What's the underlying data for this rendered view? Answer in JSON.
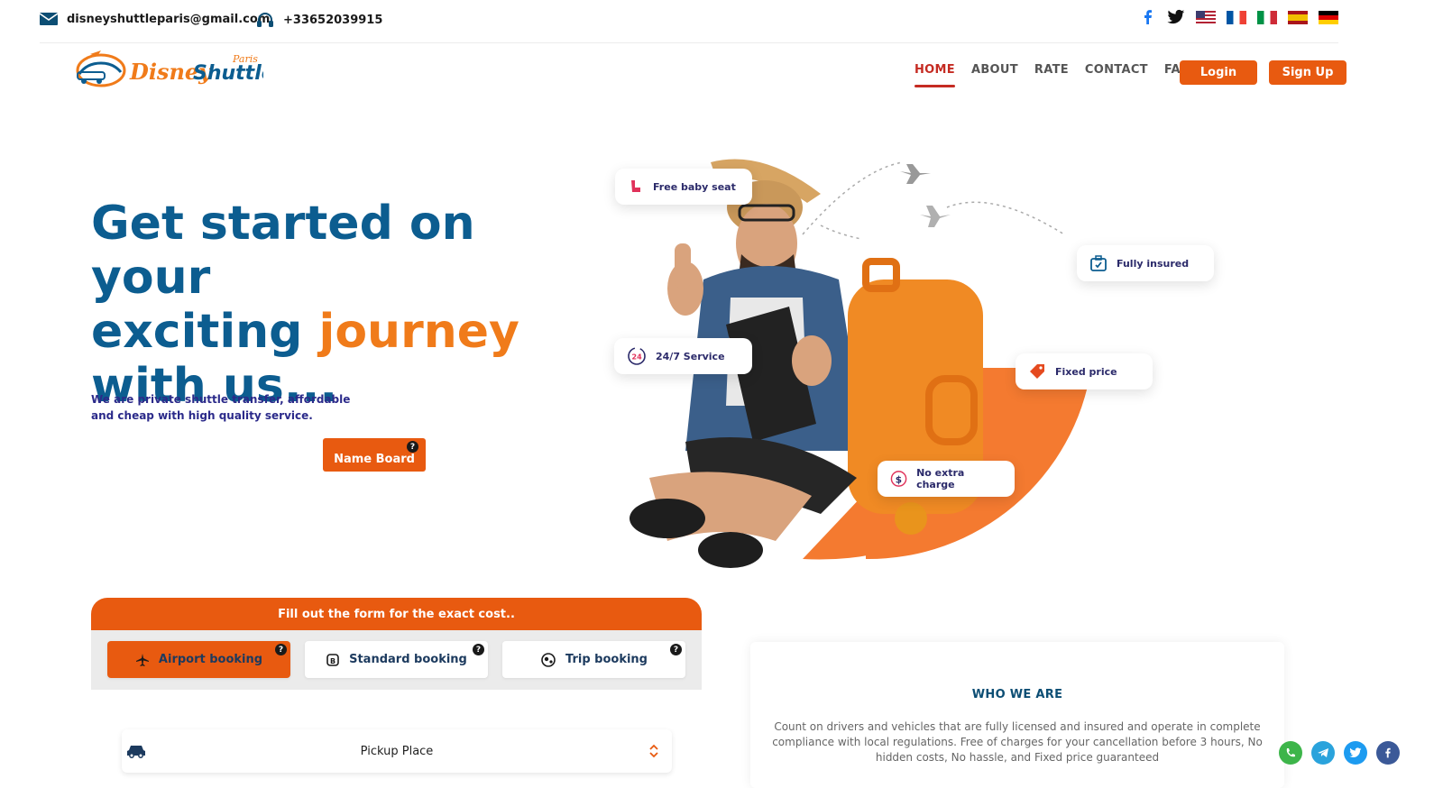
{
  "topbar": {
    "email": "disneyshuttleparis@gmail.com",
    "phone": "+33652039915",
    "icons": [
      "mail-icon",
      "headset-icon",
      "facebook-icon",
      "twitter-icon"
    ],
    "flags": [
      "flag-us",
      "flag-fr",
      "flag-it",
      "flag-es",
      "flag-de"
    ]
  },
  "logo": {
    "main_a": "Disney",
    "main_b": "Shuttle",
    "sub": "Paris"
  },
  "nav": {
    "items": [
      "HOME",
      "ABOUT",
      "RATE",
      "CONTACT",
      "FAQ"
    ],
    "active": "HOME",
    "login": "Login",
    "signup": "Sign Up"
  },
  "hero": {
    "title_line1": "Get started on your",
    "title_line2a": "exciting",
    "title_line2b": "journey",
    "title_line3": "with us...",
    "subtitle": "We are private shuttle transfer, affordable and cheap with high quality service.",
    "cta": "Name Board",
    "help_badge": "?"
  },
  "features": [
    {
      "label": "Free baby seat",
      "icon": "baby-seat-icon"
    },
    {
      "label": "Fully insured",
      "icon": "insured-icon"
    },
    {
      "label": "24/7 Service",
      "icon": "clock-24-icon"
    },
    {
      "label": "Fixed price",
      "icon": "price-tag-icon"
    },
    {
      "label": "No extra charge",
      "icon": "dollar-icon"
    }
  ],
  "form": {
    "header": "Fill out the form for the exact cost..",
    "tabs": [
      {
        "label": "Airport booking",
        "icon": "plane-icon",
        "active": true
      },
      {
        "label": "Standard booking",
        "icon": "standard-icon",
        "active": false
      },
      {
        "label": "Trip booking",
        "icon": "trip-icon",
        "active": false
      }
    ],
    "pickup_label": "Pickup Place"
  },
  "who": {
    "title": "WHO WE ARE",
    "text": "Count on drivers and vehicles that are fully licensed and insured and operate in complete compliance with local regulations. Free of charges for your cancellation before 3 hours, No hidden costs, No hassle, and Fixed price guaranteed"
  },
  "colors": {
    "brand_orange": "#e85a10",
    "brand_blue": "#0c5d90",
    "accent_orange": "#f07b1a",
    "active_red": "#c52b22"
  }
}
